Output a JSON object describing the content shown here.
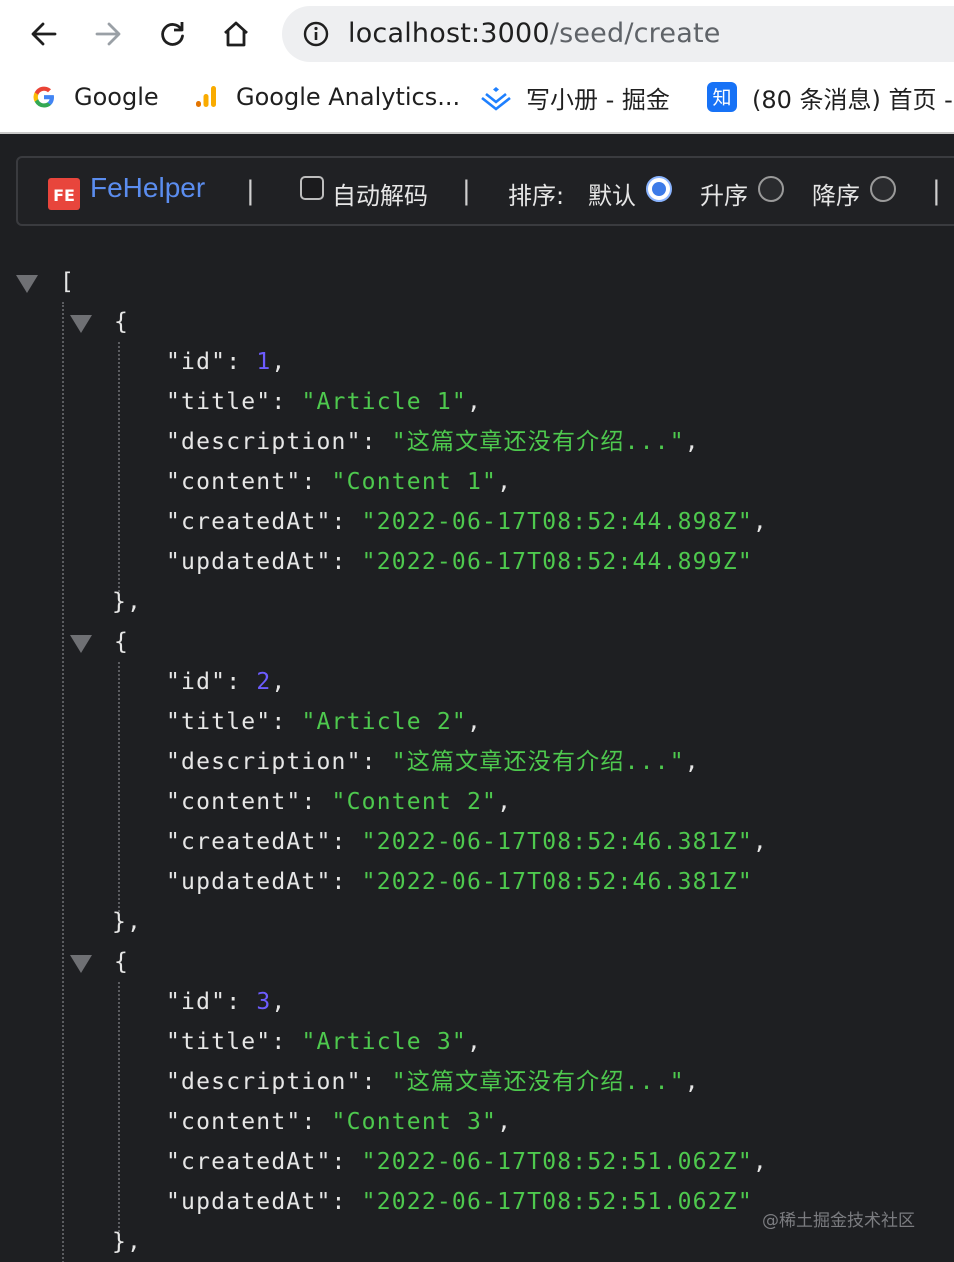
{
  "browser": {
    "url": {
      "host": "localhost:3000",
      "path": "/seed/create"
    },
    "bookmarks": [
      {
        "label": "Google",
        "icon": "google-icon"
      },
      {
        "label": "Google Analytics...",
        "icon": "analytics-icon"
      },
      {
        "label": "写小册 - 掘金",
        "icon": "juejin-icon"
      },
      {
        "label": "(80 条消息) 首页 -",
        "icon": "zhihu-icon"
      }
    ]
  },
  "toolbar": {
    "brand": "FeHelper",
    "separator": "|",
    "auto_decode_label": "自动解码",
    "auto_decode_checked": false,
    "sort_label": "排序:",
    "sort_options": [
      {
        "label": "默认",
        "checked": true
      },
      {
        "label": "升序",
        "checked": false
      },
      {
        "label": "降序",
        "checked": false
      }
    ]
  },
  "json": {
    "open_bracket": "[",
    "open_brace": "{",
    "close_brace": "},",
    "records": [
      {
        "id": "1",
        "title": "\"Article 1\"",
        "description": "\"这篇文章还没有介绍...\"",
        "content": "\"Content 1\"",
        "createdAt": "\"2022-06-17T08:52:44.898Z\"",
        "updatedAt": "\"2022-06-17T08:52:44.899Z\""
      },
      {
        "id": "2",
        "title": "\"Article 2\"",
        "description": "\"这篇文章还没有介绍...\"",
        "content": "\"Content 2\"",
        "createdAt": "\"2022-06-17T08:52:46.381Z\"",
        "updatedAt": "\"2022-06-17T08:52:46.381Z\""
      },
      {
        "id": "3",
        "title": "\"Article 3\"",
        "description": "\"这篇文章还没有介绍...\"",
        "content": "\"Content 3\"",
        "createdAt": "\"2022-06-17T08:52:51.062Z\"",
        "updatedAt": "\"2022-06-17T08:52:51.062Z\""
      }
    ],
    "keys": {
      "id": "\"id\"",
      "title": "\"title\"",
      "description": "\"description\"",
      "content": "\"content\"",
      "createdAt": "\"createdAt\"",
      "updatedAt": "\"updatedAt\""
    }
  },
  "watermark": "@稀土掘金技术社区",
  "colors": {
    "string": "#4ec94e",
    "number": "#6d5cff",
    "brand": "#5b8def",
    "background": "#1e1f22"
  }
}
